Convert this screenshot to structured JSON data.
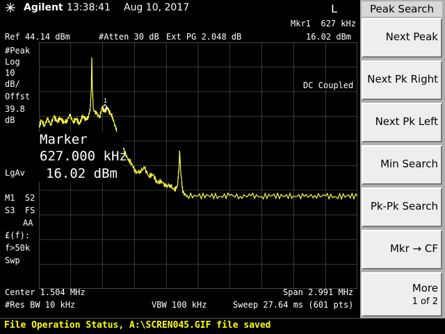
{
  "header": {
    "brand": "Agilent",
    "time": "13:38:41",
    "date": "Aug 10, 2017",
    "mode_letter": "L"
  },
  "display": {
    "ref_level": "Ref 44.14 dBm",
    "atten": "#Atten 30 dB",
    "ext_pg": "Ext PG 2.048 dB",
    "mkr_freq": "Mkr1  627 kHz",
    "mkr_amp": "16.02 dBm",
    "left_annot": [
      "#Peak",
      "Log",
      "10",
      "dB/",
      "Offst",
      "39.8",
      "dB"
    ],
    "dc_coupled": "DC Coupled",
    "lgav": "LgAv",
    "m1s2": "M1  S2",
    "s3fs": "S3  FS",
    "aa": "AA",
    "ff": "£(f):",
    "f50k": "f>50k",
    "swp": "Swp",
    "marker_title": "Marker",
    "marker_freq": "627.000 kHz",
    "marker_amp": "16.02 dBm",
    "marker_number": "1",
    "center": "Center 1.504 MHz",
    "span": "Span 2.991 MHz",
    "res_bw": "#Res BW 10 kHz",
    "vbw": "VBW 100 kHz",
    "sweep": "Sweep 27.64 ms (601 pts)"
  },
  "status": {
    "message": "File Operation Status, A:\\SCREN045.GIF file saved"
  },
  "softkeys": {
    "title": "Peak Search",
    "items": [
      {
        "label": "Next Peak",
        "sub": ""
      },
      {
        "label": "Next Pk Right",
        "sub": ""
      },
      {
        "label": "Next Pk Left",
        "sub": ""
      },
      {
        "label": "Min Search",
        "sub": ""
      },
      {
        "label": "Pk-Pk Search",
        "sub": ""
      },
      {
        "label": "Mkr → CF",
        "sub": ""
      },
      {
        "label": "More",
        "sub": "1 of 2"
      }
    ]
  },
  "colors": {
    "trace": "#ffff40",
    "grid": "#707070",
    "status_text": "#ffff00"
  },
  "trace": {
    "note_units": "dBm",
    "ref_dbm": 44.14,
    "db_per_div": 10,
    "divisions": 10,
    "start_mhz": 0.0085,
    "stop_mhz": 2.9995,
    "marker_freq_mhz": 0.627,
    "marker_amp_dbm": 16.02,
    "points": [
      [
        0.0085,
        9.5
      ],
      [
        0.03,
        12.5
      ],
      [
        0.06,
        10.5
      ],
      [
        0.09,
        13.0
      ],
      [
        0.12,
        11.0
      ],
      [
        0.15,
        14.0
      ],
      [
        0.18,
        12.0
      ],
      [
        0.21,
        13.5
      ],
      [
        0.24,
        11.5
      ],
      [
        0.27,
        12.5
      ],
      [
        0.3,
        14.5
      ],
      [
        0.33,
        12.0
      ],
      [
        0.36,
        13.0
      ],
      [
        0.39,
        11.0
      ],
      [
        0.42,
        14.5
      ],
      [
        0.45,
        12.5
      ],
      [
        0.47,
        14.0
      ],
      [
        0.49,
        16.5
      ],
      [
        0.5,
        25.0
      ],
      [
        0.505,
        38.0
      ],
      [
        0.51,
        26.0
      ],
      [
        0.52,
        17.0
      ],
      [
        0.55,
        15.0
      ],
      [
        0.58,
        14.0
      ],
      [
        0.6,
        17.5
      ],
      [
        0.627,
        16.02
      ],
      [
        0.65,
        17.8
      ],
      [
        0.68,
        15.0
      ],
      [
        0.7,
        14.0
      ],
      [
        0.73,
        9.0
      ],
      [
        0.76,
        5.0
      ],
      [
        0.8,
        1.0
      ],
      [
        0.84,
        -3.0
      ],
      [
        0.88,
        -5.0
      ],
      [
        0.92,
        -9.0
      ],
      [
        0.96,
        -8.0
      ],
      [
        1.0,
        -7.0
      ],
      [
        1.04,
        -10.0
      ],
      [
        1.08,
        -9.5
      ],
      [
        1.12,
        -13.0
      ],
      [
        1.16,
        -12.0
      ],
      [
        1.2,
        -14.5
      ],
      [
        1.24,
        -13.5
      ],
      [
        1.28,
        -16.0
      ],
      [
        1.31,
        -14.0
      ],
      [
        1.325,
        -6.0
      ],
      [
        1.33,
        0.0
      ],
      [
        1.34,
        -8.0
      ],
      [
        1.36,
        -17.0
      ],
      [
        1.4,
        -18.0
      ],
      [
        1.5,
        -18.3
      ],
      [
        1.6,
        -18.0
      ],
      [
        1.7,
        -18.4
      ],
      [
        1.8,
        -18.0
      ],
      [
        1.9,
        -18.3
      ],
      [
        2.0,
        -18.1
      ],
      [
        2.1,
        -18.4
      ],
      [
        2.2,
        -18.0
      ],
      [
        2.3,
        -18.3
      ],
      [
        2.4,
        -18.1
      ],
      [
        2.5,
        -18.4
      ],
      [
        2.6,
        -18.0
      ],
      [
        2.7,
        -18.2
      ],
      [
        2.8,
        -18.5
      ],
      [
        2.9,
        -18.1
      ],
      [
        2.9995,
        -18.3
      ]
    ]
  }
}
